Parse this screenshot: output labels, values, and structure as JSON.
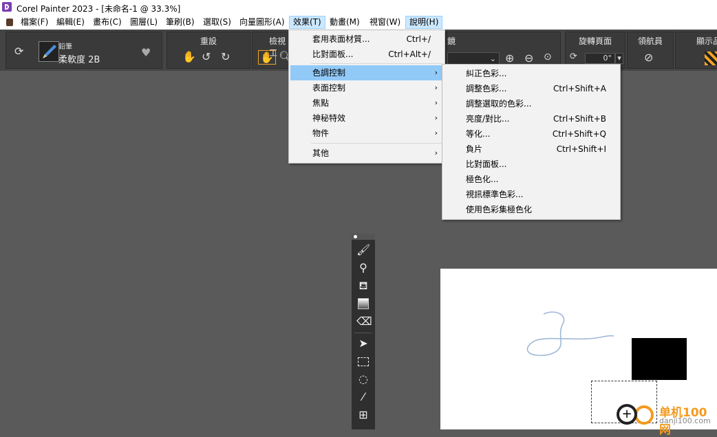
{
  "window": {
    "title": "Corel Painter 2023 - [未命名-1 @ 33.3%]"
  },
  "menubar": [
    {
      "label": "檔案(F)"
    },
    {
      "label": "編輯(E)"
    },
    {
      "label": "畫布(C)"
    },
    {
      "label": "圖層(L)"
    },
    {
      "label": "筆刷(B)"
    },
    {
      "label": "選取(S)"
    },
    {
      "label": "向量圖形(A)"
    },
    {
      "label": "效果(T)",
      "active": true
    },
    {
      "label": "動畫(M)"
    },
    {
      "label": "視窗(W)"
    },
    {
      "label": "說明(H)",
      "active": true
    }
  ],
  "toolbar": {
    "brush_category": "鉛筆",
    "brush_variant": "柔軟度 2B",
    "reset_heading": "重設",
    "view_heading": "檢視工",
    "mirror_heading": "鏡",
    "rotate_heading": "旋轉頁面",
    "rotate_value": "0°",
    "navigator_heading": "領航員",
    "display_heading": "顯示品"
  },
  "effects_menu": {
    "items": [
      {
        "label": "套用表面材質...",
        "shortcut": "Ctrl+/"
      },
      {
        "label": "比對面板...",
        "shortcut": "Ctrl+Alt+/"
      },
      {
        "label": "色調控制",
        "submenu": true,
        "highlighted": true
      },
      {
        "label": "表面控制",
        "submenu": true
      },
      {
        "label": "焦點",
        "submenu": true
      },
      {
        "label": "神秘特效",
        "submenu": true
      },
      {
        "label": "物件",
        "submenu": true
      },
      {
        "label": "其他",
        "submenu": true
      }
    ]
  },
  "tonal_submenu": {
    "items": [
      {
        "label": "糾正色彩...",
        "shortcut": ""
      },
      {
        "label": "調整色彩...",
        "shortcut": "Ctrl+Shift+A"
      },
      {
        "label": "調整選取的色彩...",
        "shortcut": ""
      },
      {
        "label": "亮度/對比...",
        "shortcut": "Ctrl+Shift+B"
      },
      {
        "label": "等化...",
        "shortcut": "Ctrl+Shift+Q"
      },
      {
        "label": "負片",
        "shortcut": "Ctrl+Shift+I"
      },
      {
        "label": "比對面板...",
        "shortcut": ""
      },
      {
        "label": "極色化...",
        "shortcut": ""
      },
      {
        "label": "視訊標準色彩...",
        "shortcut": ""
      },
      {
        "label": "使用色彩集極色化",
        "shortcut": ""
      }
    ]
  },
  "watermark": {
    "name": "单机100网",
    "url": "danji100.com"
  },
  "colors": {
    "highlight": "#91c9f7",
    "menubar_active": "#cce8ff",
    "workspace": "#5a5a5a",
    "stroke": "#9fb8d8",
    "watermark_orange": "#f39a1e"
  }
}
